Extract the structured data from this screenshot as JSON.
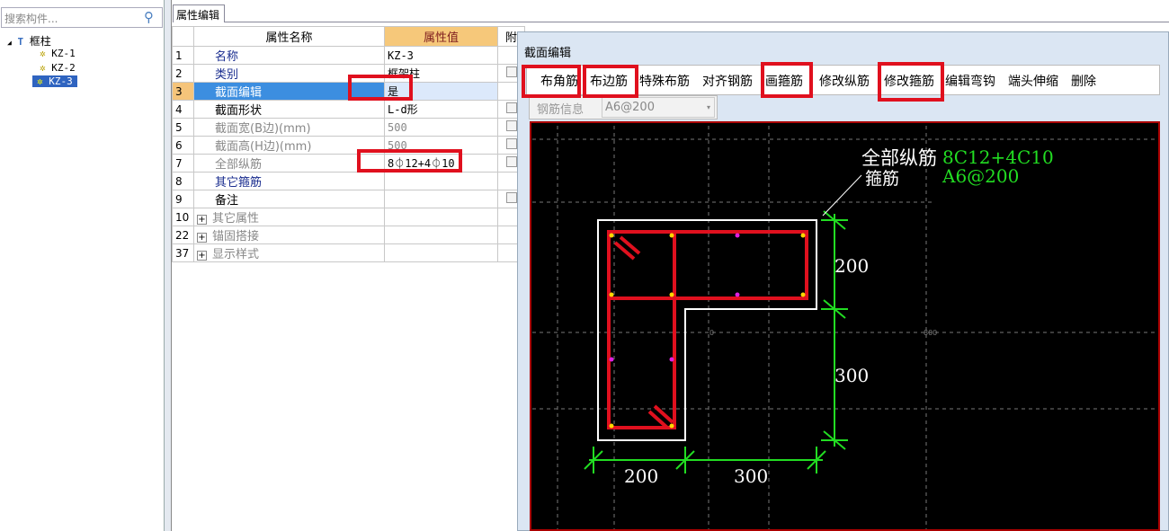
{
  "search": {
    "placeholder": "搜索构件..."
  },
  "tree": {
    "root": "框柱",
    "items": [
      "KZ-1",
      "KZ-2",
      "KZ-3"
    ],
    "selected": "KZ-3"
  },
  "tab": "属性编辑",
  "grid": {
    "headers": {
      "name": "属性名称",
      "value": "属性值",
      "attach": "附"
    },
    "rows": [
      {
        "num": "1",
        "name": "名称",
        "value": "KZ-3"
      },
      {
        "num": "2",
        "name": "类别",
        "value": "框架柱"
      },
      {
        "num": "3",
        "name": "截面编辑",
        "value": "是"
      },
      {
        "num": "4",
        "name": "截面形状",
        "value": "L-d形"
      },
      {
        "num": "5",
        "name": "截面宽(B边)(mm)",
        "value": "500"
      },
      {
        "num": "6",
        "name": "截面高(H边)(mm)",
        "value": "500"
      },
      {
        "num": "7",
        "name": "全部纵筋",
        "value": "8⏀12+4⏀10"
      },
      {
        "num": "8",
        "name": "其它箍筋",
        "value": ""
      },
      {
        "num": "9",
        "name": "备注",
        "value": ""
      },
      {
        "num": "10",
        "name": "其它属性",
        "value": ""
      },
      {
        "num": "22",
        "name": "锚固搭接",
        "value": ""
      },
      {
        "num": "37",
        "name": "显示样式",
        "value": ""
      }
    ]
  },
  "dialog": {
    "title": "截面编辑",
    "toolbar": [
      "布角筋",
      "布边筋",
      "特殊布筋",
      "对齐钢筋",
      "画箍筋",
      "修改纵筋",
      "修改箍筋",
      "编辑弯钩",
      "端头伸缩",
      "删除"
    ],
    "info_label": "钢筋信息",
    "info_value": "A6@200",
    "canvas": {
      "label_long": "全部纵筋",
      "label_stirrup": "箍筋",
      "long_value": "8C12+4C10",
      "stirrup_value": "A6@200",
      "dims": [
        "200",
        "300",
        "200",
        "300"
      ],
      "axis": [
        "0",
        "800"
      ]
    }
  },
  "colors": {
    "highlight": "#e0101e",
    "dim": "#22dd22",
    "stirrup": "#e0101e"
  }
}
